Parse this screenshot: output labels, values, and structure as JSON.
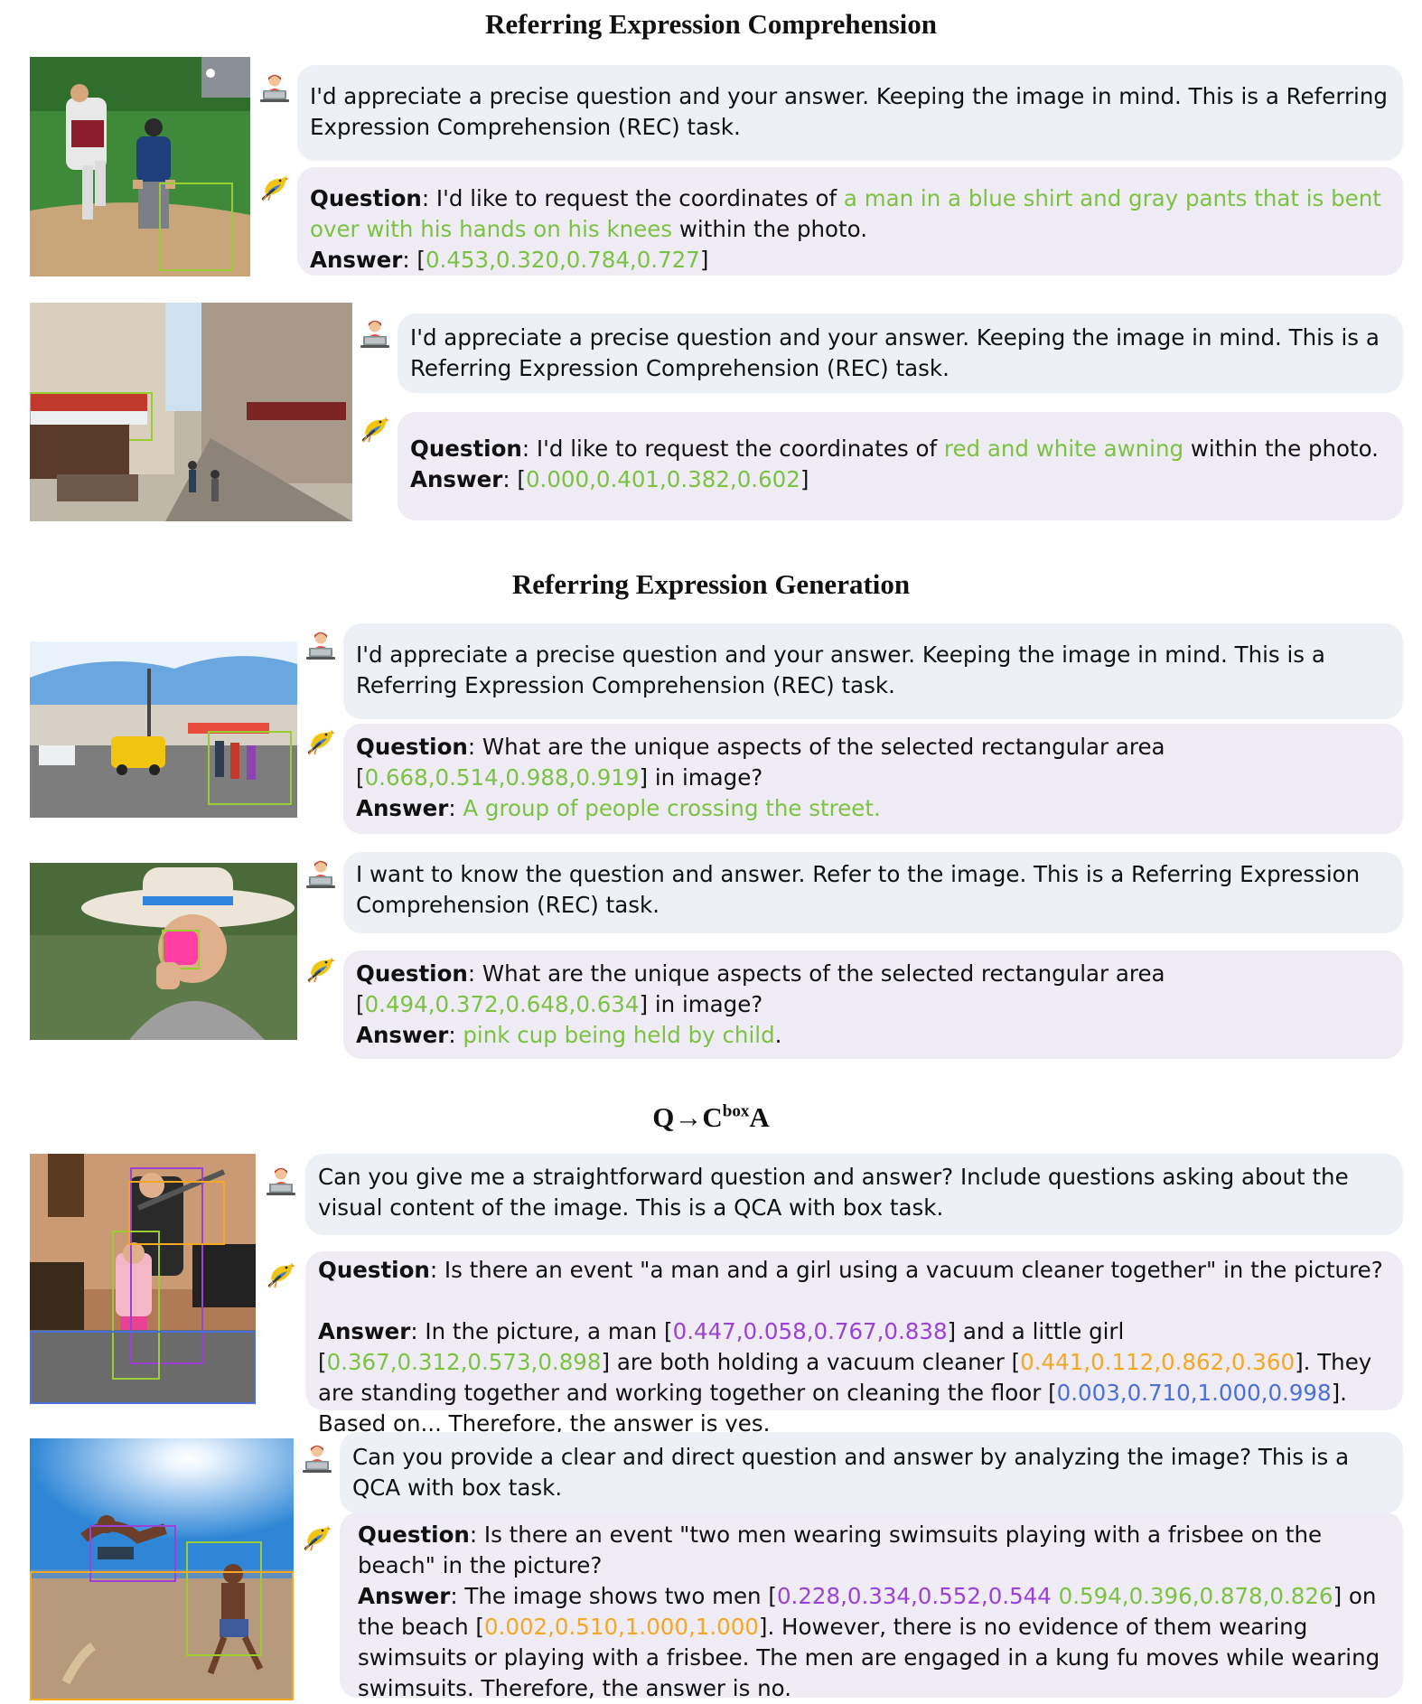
{
  "sections": {
    "rec_title": "Referring Expression Comprehension",
    "reg_title": "Referring Expression Generation",
    "qca_title_q": "Q",
    "qca_title_arrow": "→",
    "qca_title_c": "C",
    "qca_title_sup": "box",
    "qca_title_a": "A"
  },
  "icons": {
    "user": "user-at-laptop-icon",
    "assistant": "bird-assistant-icon"
  },
  "colors": {
    "green": "#7cc242",
    "purple": "#9b41d6",
    "orange": "#f5a623",
    "blue": "#4a6fd8",
    "user_bubble": "#edf1f6",
    "bot_bubble": "#f0ecf6"
  },
  "labels": {
    "question": "Question",
    "answer": "Answer",
    "colon": ": "
  },
  "examples": {
    "ex1": {
      "prompt": "I'd appreciate a precise question and your answer. Keeping the image in mind. This is a Referring Expression Comprehension (REC) task.",
      "q_pre": "I'd like to request the coordinates of ",
      "q_hl": "a man in a blue shirt and gray pants that is bent over with his hands on his knees",
      "q_post": " within the photo.",
      "a_open": "[",
      "a_hl": "0.453,0.320,0.784,0.727",
      "a_close": "]"
    },
    "ex2": {
      "prompt": "I'd appreciate a precise question and your answer. Keeping the image in mind. This is a Referring Expression Comprehension (REC) task.",
      "q_pre": "I'd like to request the coordinates of ",
      "q_hl": "red and white awning",
      "q_post": " within the photo.",
      "a_open": "[",
      "a_hl": "0.000,0.401,0.382,0.602",
      "a_close": "]"
    },
    "ex3": {
      "prompt": "I'd appreciate a precise question and your answer. Keeping the image in mind. This is a Referring Expression Comprehension (REC) task.",
      "q_pre": "What are the unique aspects of the selected rectangular area [",
      "q_hl": "0.668,0.514,0.988,0.919",
      "q_post": "] in image?",
      "a_hl": "A group of people crossing the street."
    },
    "ex4": {
      "prompt": "I want to know the question and answer. Refer to the image. This is a Referring Expression Comprehension (REC) task.",
      "q_pre": "What are the unique aspects of the selected rectangular area [",
      "q_hl": "0.494,0.372,0.648,0.634",
      "q_post": "] in image?",
      "a_hl": "pink cup being held by child",
      "a_post": "."
    },
    "ex5": {
      "prompt": "Can you give me a straightforward question and answer? Include questions asking about the visual content of the image. This is a QCA with box task.",
      "q_text": "Is there an event \"a man and a girl using a vacuum cleaner together\" in the picture?",
      "a1": "In the picture, a man [",
      "box_man": "0.447,0.058,0.767,0.838",
      "a2": "] and a little girl [",
      "box_girl": "0.367,0.312,0.573,0.898",
      "a3": "] are both holding a vacuum cleaner [",
      "box_vac": "0.441,0.112,0.862,0.360",
      "a4": "]. They are standing together and working together on cleaning the floor [",
      "box_floor": "0.003,0.710,1.000,0.998",
      "a5": "]. Based on... Therefore, the answer is yes."
    },
    "ex6": {
      "prompt": "Can you provide a clear and direct question and answer by analyzing the image? This is a QCA with box task.",
      "q_text": "Is there an event \"two men wearing swimsuits playing with a frisbee on the beach\" in the picture?",
      "a1": "The image shows two men [",
      "box_m1": "0.228,0.334,0.552,0.544",
      "box_m2": "0.594,0.396,0.878,0.826",
      "a2": "] on the beach [",
      "box_beach": "0.002,0.510,1.000,1.000",
      "a3": "]. However, there is no evidence of them wearing swimsuits or playing with a frisbee. The men are engaged in a kung fu moves while wearing swimsuits. Therefore, the answer is no."
    }
  }
}
